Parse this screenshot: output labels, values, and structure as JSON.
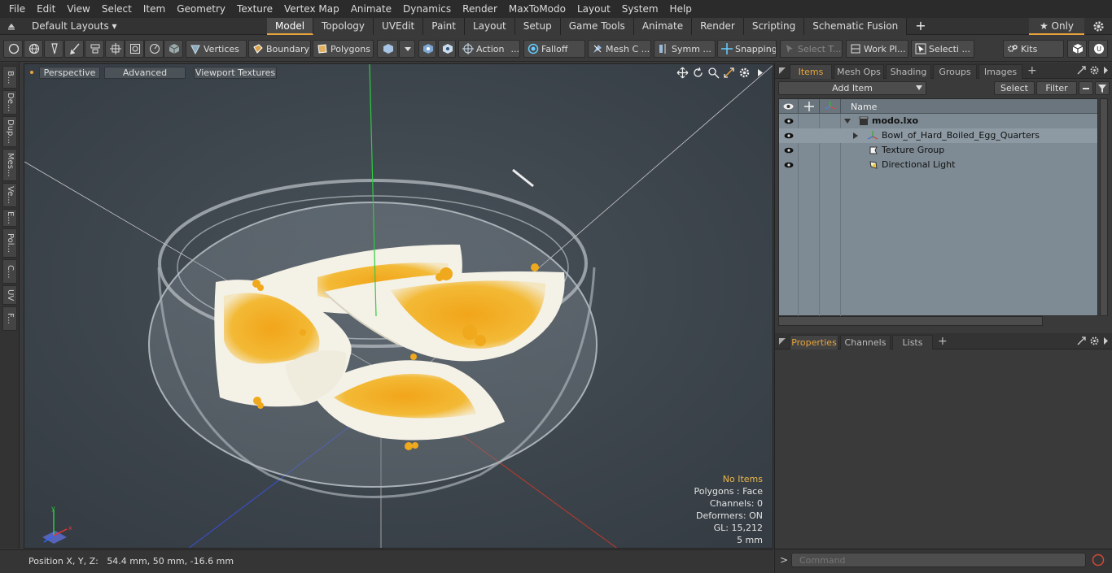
{
  "menubar": {
    "items": [
      "File",
      "Edit",
      "View",
      "Select",
      "Item",
      "Geometry",
      "Texture",
      "Vertex Map",
      "Animate",
      "Dynamics",
      "Render",
      "MaxToModo",
      "Layout",
      "System",
      "Help"
    ]
  },
  "layoutbar": {
    "layout_name": "Default Layouts ▾",
    "tabs": [
      "Model",
      "Topology",
      "UVEdit",
      "Paint",
      "Layout",
      "Setup",
      "Game Tools",
      "Animate",
      "Render",
      "Scripting",
      "Schematic Fusion"
    ],
    "active_tab": "Model",
    "plus": "+",
    "only_label": "★  Only"
  },
  "toolbar": {
    "vertices": "Vertices",
    "boundary": "Boundary",
    "polygons": "Polygons",
    "action": "Action",
    "action_more": "...",
    "falloff": "Falloff",
    "mesh": "Mesh C ...",
    "symm": "Symm ...",
    "snapping": "Snapping",
    "select_t": "Select T...",
    "work_pl": "Work Pl...",
    "selecti": "Selecti ...",
    "kits": "Kits"
  },
  "leftstrip": {
    "tabs": [
      "B...",
      "De...",
      "Dup...",
      "Mes...",
      "Ve...",
      "E...",
      "Pol...",
      "C...",
      "UV",
      "F..."
    ]
  },
  "viewport": {
    "perspective": "Perspective",
    "advanced": "Advanced",
    "viewport_textures": "Viewport Textures",
    "info": {
      "no_items": "No Items",
      "polygons": "Polygons : Face",
      "channels": "Channels: 0",
      "deformers": "Deformers: ON",
      "gl": "GL: 15,212",
      "scale": "5 mm"
    },
    "colors": {
      "background": "#3f474f",
      "yolk": "#f0a81c",
      "white": "#f4f1e6"
    }
  },
  "statusbar": {
    "position_label": "Position X, Y, Z:",
    "position_value": "54.4 mm, 50 mm, -16.6 mm"
  },
  "items_panel": {
    "tabs": [
      "Items",
      "Mesh Ops",
      "Shading",
      "Groups",
      "Images"
    ],
    "active_tab": "Items",
    "plus": "+",
    "add_item": "Add Item",
    "select": "Select",
    "filter": "Filter",
    "name_header": "Name",
    "tree": [
      {
        "label": "modo.lxo",
        "icon": "scene-icon",
        "bold": true
      },
      {
        "label": "Bowl_of_Hard_Boiled_Egg_Quarters",
        "icon": "mesh-locator-icon"
      },
      {
        "label": "Texture Group",
        "icon": "texture-group-icon"
      },
      {
        "label": "Directional Light",
        "icon": "light-icon"
      }
    ]
  },
  "properties_panel": {
    "tabs": [
      "Properties",
      "Channels",
      "Lists"
    ],
    "active_tab": "Properties",
    "plus": "+"
  },
  "command": {
    "prompt": ">",
    "placeholder": "Command"
  },
  "accent_color": "#e8a33d"
}
